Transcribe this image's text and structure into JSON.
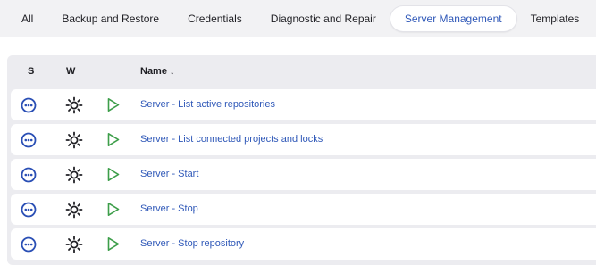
{
  "tabs": [
    {
      "label": "All",
      "active": false
    },
    {
      "label": "Backup and Restore",
      "active": false
    },
    {
      "label": "Credentials",
      "active": false
    },
    {
      "label": "Diagnostic and Repair",
      "active": false
    },
    {
      "label": "Server Management",
      "active": true
    },
    {
      "label": "Templates",
      "active": false
    }
  ],
  "add_tab_label": "+",
  "table": {
    "headers": {
      "status": "S",
      "weather": "W",
      "name": "Name ↓"
    },
    "rows": [
      {
        "name": "Server - List active repositories",
        "status_icon": "status-not-built-icon",
        "weather_icon": "weather-sunny-icon",
        "run_icon": "play-icon"
      },
      {
        "name": "Server - List connected projects and locks",
        "status_icon": "status-not-built-icon",
        "weather_icon": "weather-sunny-icon",
        "run_icon": "play-icon"
      },
      {
        "name": "Server - Start",
        "status_icon": "status-not-built-icon",
        "weather_icon": "weather-sunny-icon",
        "run_icon": "play-icon"
      },
      {
        "name": "Server - Stop",
        "status_icon": "status-not-built-icon",
        "weather_icon": "weather-sunny-icon",
        "run_icon": "play-icon"
      },
      {
        "name": "Server - Stop repository",
        "status_icon": "status-not-built-icon",
        "weather_icon": "weather-sunny-icon",
        "run_icon": "play-icon"
      }
    ]
  },
  "colors": {
    "accent": "#2f58b8",
    "status_icon": "#2a4fb5",
    "play_icon": "#3d9e4a",
    "header_bg": "#ececf0"
  }
}
